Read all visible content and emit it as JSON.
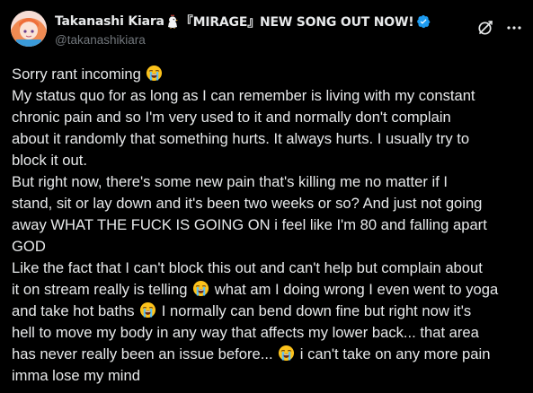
{
  "post": {
    "display_name": "Takanashi Kiara",
    "display_name_suffix": "『MIRAGE』NEW SONG OUT NOW!",
    "name_emoji": "chicken-icon",
    "verified_color": "#1d9bf0",
    "handle": "@takanashikiara",
    "icons": {
      "grok": "grok-icon",
      "more": "more-icon"
    },
    "lines": [
      {
        "text": "Sorry rant incoming ",
        "emoji": true
      },
      {
        "text": "My status quo for as long as I can remember is living with my constant"
      },
      {
        "text": "chronic pain and so I'm very used to it and normally don't complain"
      },
      {
        "text": "about it randomly that something hurts. It always hurts. I usually try to"
      },
      {
        "text": "block it out."
      },
      {
        "text": "But right now, there's some new pain that's killing me no matter if I"
      },
      {
        "text": "stand, sit or lay down and it's been two weeks or so? And just not going"
      },
      {
        "text": "away WHAT THE FUCK IS GOING ON i feel like I'm 80 and falling apart"
      },
      {
        "text": "GOD"
      },
      {
        "text": "Like the fact that I can't block this out and can't help but complain about"
      },
      {
        "a": "it on stream really is telling ",
        "b": " what am I doing wrong I even went to yoga"
      },
      {
        "a": "and take hot baths ",
        "b": " I normally can bend down fine but right now it's"
      },
      {
        "text": "hell to move my body in any way that affects my lower back... that area"
      },
      {
        "a": "has never really been an issue before... ",
        "b": " i can't take on any more pain"
      },
      {
        "text": "imma lose my mind"
      }
    ],
    "emoji_name": "loudly-crying-face-icon"
  }
}
